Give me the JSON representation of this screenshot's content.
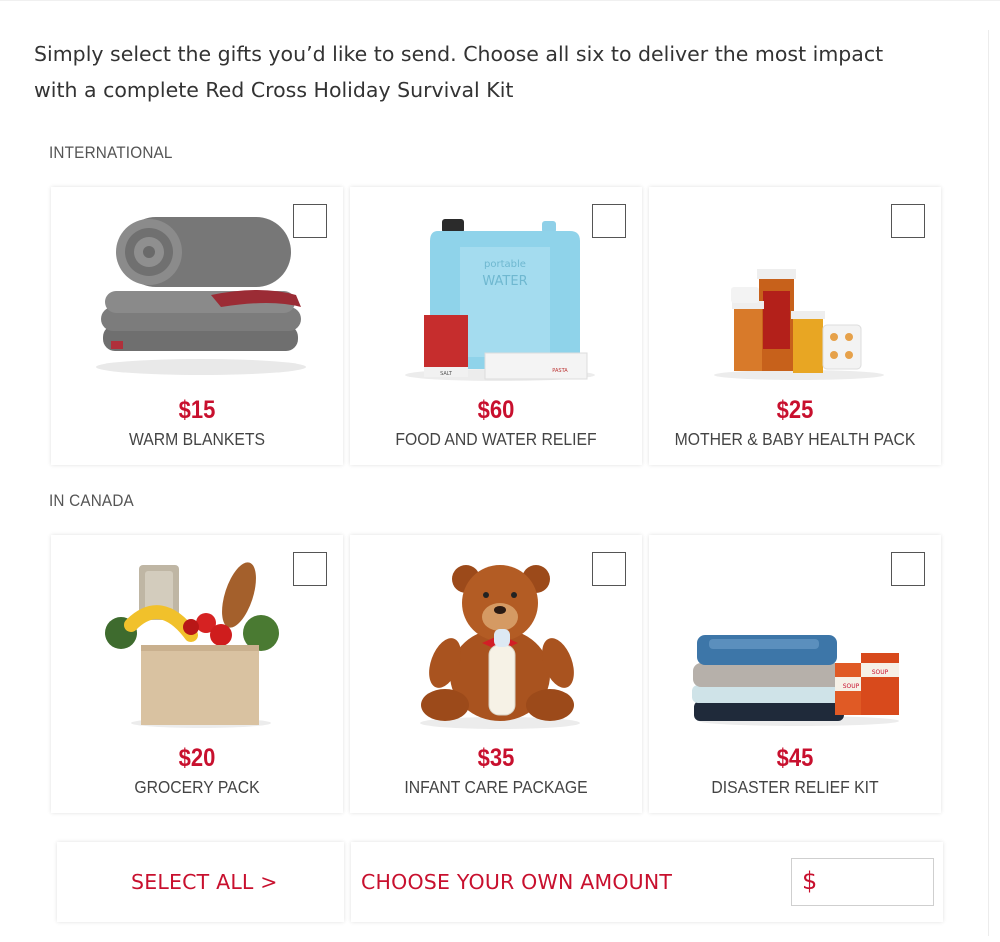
{
  "intro": {
    "line1": "Simply select the gifts you’d like to send. Choose all six to deliver the most impact",
    "line2": "with a complete Red Cross Holiday Survival Kit"
  },
  "sections": {
    "international": "INTERNATIONAL",
    "canada": "IN CANADA"
  },
  "gifts": [
    {
      "price": "$15",
      "name": "WARM BLANKETS",
      "icon": "blanket-icon"
    },
    {
      "price": "$60",
      "name": "FOOD AND WATER RELIEF",
      "icon": "water-jug-icon",
      "jug_text_1": "portable",
      "jug_text_2": "WATER",
      "box_1": "SALT",
      "box_2": "PASTA"
    },
    {
      "price": "$25",
      "name": "MOTHER & BABY HEALTH PACK",
      "icon": "medicine-icon"
    },
    {
      "price": "$20",
      "name": "GROCERY PACK",
      "icon": "grocery-bag-icon"
    },
    {
      "price": "$35",
      "name": "INFANT CARE PACKAGE",
      "icon": "teddy-bear-icon"
    },
    {
      "price": "$45",
      "name": "DISASTER RELIEF KIT",
      "icon": "clothes-and-soup-icon",
      "can_1": "SOUP",
      "can_2": "SOUP"
    }
  ],
  "actions": {
    "select_all": "SELECT ALL >",
    "choose_amount": "CHOOSE YOUR OWN AMOUNT",
    "currency": "$",
    "amount_value": ""
  },
  "colors": {
    "accent": "#c8102e",
    "text": "#333333"
  }
}
